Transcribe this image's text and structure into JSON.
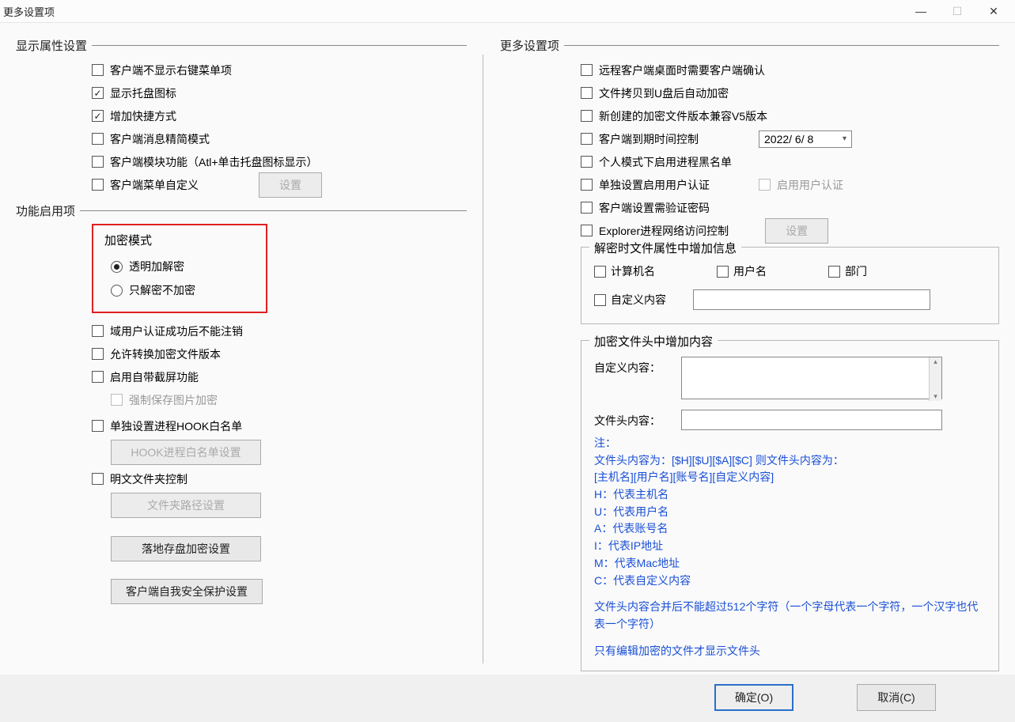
{
  "window": {
    "title": "更多设置项"
  },
  "left": {
    "section_display": "显示属性设置",
    "display": {
      "hide_context_menu": "客户端不显示右键菜单项",
      "show_tray": "显示托盘图标",
      "add_shortcut": "增加快捷方式",
      "msg_lite": "客户端消息精简模式",
      "module_fn": "客户端模块功能（Atl+单击托盘图标显示）",
      "menu_custom": "客户端菜单自定义",
      "btn_settings": "设置"
    },
    "section_enable": "功能启用项",
    "enc_mode": {
      "title": "加密模式",
      "transparent": "透明加解密",
      "decrypt_only": "只解密不加密"
    },
    "enable": {
      "no_logout_after_auth": "域用户认证成功后不能注销",
      "allow_convert_ver": "允许转换加密文件版本",
      "builtin_screenshot": "启用自带截屏功能",
      "force_save_img_enc": "强制保存图片加密",
      "hook_whitelist": "单独设置进程HOOK白名单",
      "btn_hook": "HOOK进程白名单设置",
      "plain_folder_ctrl": "明文文件夹控制",
      "btn_folder": "文件夹路径设置",
      "btn_landing": "落地存盘加密设置",
      "btn_selfprotect": "客户端自我安全保护设置"
    }
  },
  "right": {
    "section_more": "更多设置项",
    "more": {
      "remote_confirm": "远程客户端桌面时需要客户端确认",
      "usb_auto_enc": "文件拷贝到U盘后自动加密",
      "v5_compat": "新创建的加密文件版本兼容V5版本",
      "expire_ctrl": "客户端到期时间控制",
      "date": "2022/ 6/ 8",
      "personal_blacklist": "个人模式下启用进程黑名单",
      "separate_auth": "单独设置启用用户认证",
      "enable_auth": "启用用户认证",
      "need_pwd": "客户端设置需验证密码",
      "explorer_net": "Explorer进程网络访问控制",
      "btn_settings": "设置"
    },
    "fs_attr": {
      "legend": "解密时文件属性中增加信息",
      "computer": "计算机名",
      "user": "用户名",
      "dept": "部门",
      "custom": "自定义内容"
    },
    "fs_head": {
      "legend": "加密文件头中增加内容",
      "custom_label": "自定义内容：",
      "head_label": "文件头内容：",
      "note_title": "注：",
      "note_l1": "文件头内容为：[$H][$U][$A][$C] 则文件头内容为：",
      "note_l2": "[主机名][用户名][账号名][自定义内容]",
      "note_h": "H：代表主机名",
      "note_u": "U：代表用户名",
      "note_a": "A：代表账号名",
      "note_i": "I：代表IP地址",
      "note_m": "M：代表Mac地址",
      "note_c": "C：代表自定义内容",
      "note_limit": "文件头内容合并后不能超过512个字符（一个字母代表一个字符，一个汉字也代表一个字符）",
      "note_only": "只有编辑加密的文件才显示文件头"
    }
  },
  "footer": {
    "ok": "确定(O)",
    "cancel": "取消(C)"
  }
}
